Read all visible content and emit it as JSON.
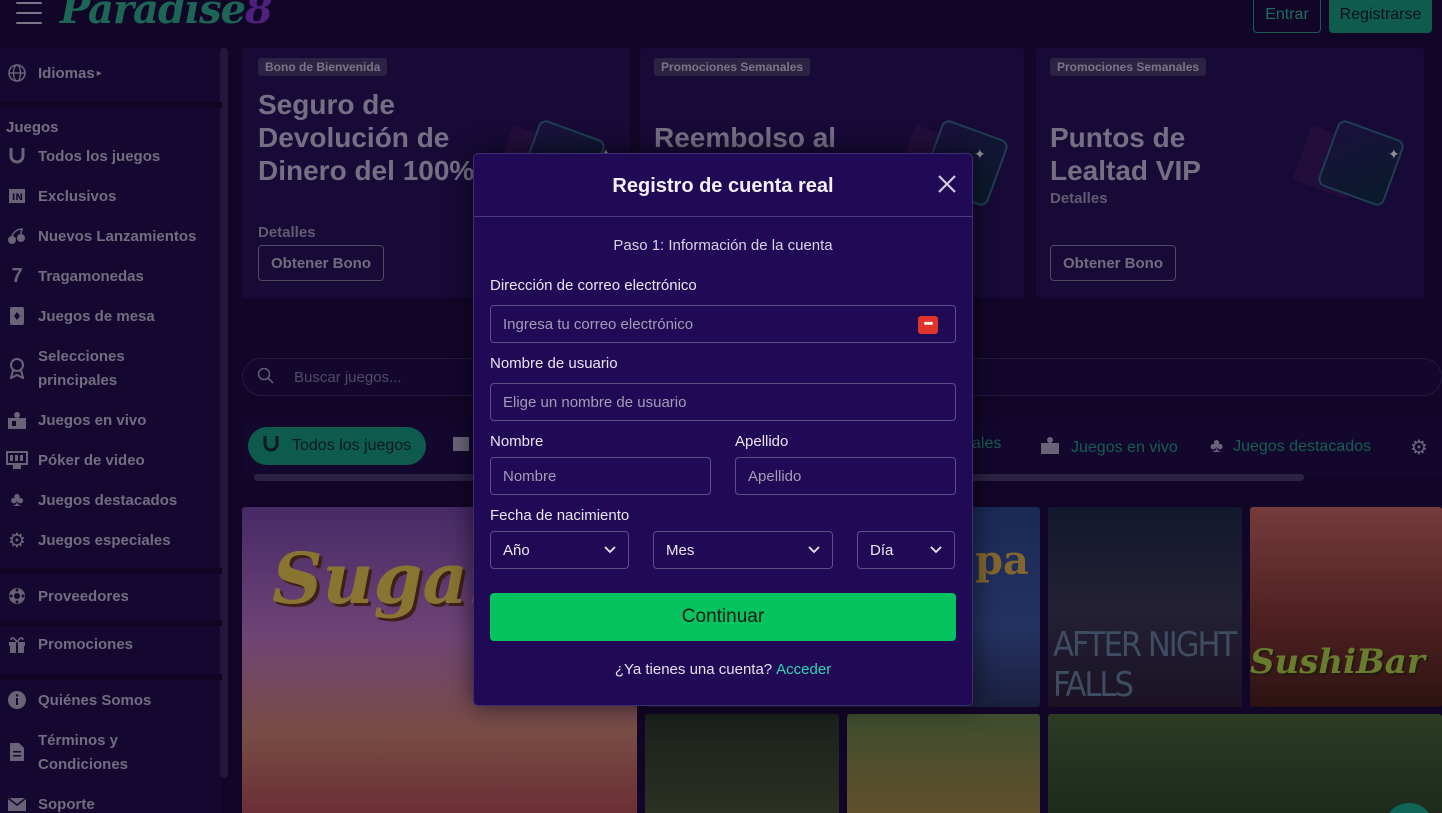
{
  "header": {
    "logo_text": "Paradise",
    "logo_number": "8",
    "login_label": "Entrar",
    "register_label": "Registrarse"
  },
  "sidebar": {
    "languages_label": "Idiomas",
    "games_heading": "Juegos",
    "items": [
      {
        "label": "Todos los juegos",
        "icon": "horseshoe-icon"
      },
      {
        "label": "Exclusivos",
        "icon": "exclusive-icon"
      },
      {
        "label": "Nuevos Lanzamientos",
        "icon": "cherries-icon"
      },
      {
        "label": "Tragamonedas",
        "icon": "seven-icon"
      },
      {
        "label": "Juegos de mesa",
        "icon": "card-icon"
      },
      {
        "label": "Selecciones principales",
        "icon": "award-icon"
      },
      {
        "label": "Juegos en vivo",
        "icon": "live-dealer-icon"
      },
      {
        "label": "Póker de video",
        "icon": "video-poker-icon"
      },
      {
        "label": "Juegos destacados",
        "icon": "clover-icon"
      },
      {
        "label": "Juegos especiales",
        "icon": "gear-icon"
      }
    ],
    "providers_label": "Proveedores",
    "promotions_label": "Promociones",
    "about_label": "Quiénes Somos",
    "terms_label": "Términos y Condiciones",
    "support_label": "Soporte"
  },
  "promos": [
    {
      "badge": "Bono de Bienvenida",
      "title": "Seguro de Devolución de Dinero del 100%",
      "link": "Detalles",
      "button": "Obtener Bono"
    },
    {
      "badge": "Promociones Semanales",
      "title": "Reembolso al",
      "link": "",
      "button": ""
    },
    {
      "badge": "Promociones Semanales",
      "title": "Puntos de Lealtad VIP",
      "link": "Detalles",
      "button": "Obtener Bono"
    }
  ],
  "search": {
    "placeholder": "Buscar juegos..."
  },
  "categories": {
    "active": "Todos los juegos",
    "partial_item": "ales",
    "live": "Juegos en vivo",
    "featured": "Juegos destacados"
  },
  "modal": {
    "title": "Registro de cuenta real",
    "step": "Paso 1: Información de la cuenta",
    "email_label": "Dirección de correo electrónico",
    "email_placeholder": "Ingresa tu correo electrónico",
    "username_label": "Nombre de usuario",
    "username_placeholder": "Elige un nombre de usuario",
    "first_name_label": "Nombre",
    "first_name_placeholder": "Nombre",
    "last_name_label": "Apellido",
    "last_name_placeholder": "Apellido",
    "dob_label": "Fecha de nacimiento",
    "year_value": "Año",
    "month_value": "Mes",
    "day_value": "Día",
    "continue_label": "Continuar",
    "have_account": "¿Ya tienes una cuenta?",
    "login_link": "Acceder"
  },
  "colors": {
    "accent": "#05c35f",
    "brand_green": "#14a77a",
    "modal_bg": "#200a55",
    "link": "#33d5b2"
  }
}
